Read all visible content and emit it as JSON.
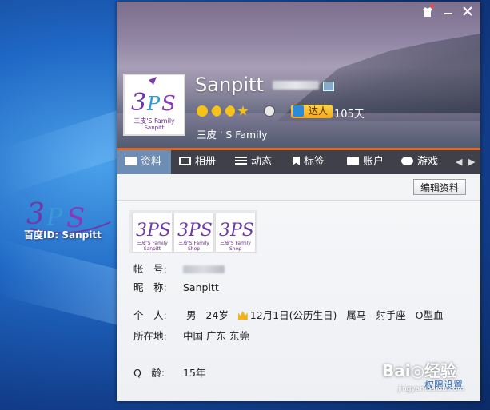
{
  "profile": {
    "nickname": "Sanpitt",
    "signature": "三皮 ' S Family",
    "days": "105天",
    "talent_badge": "达人",
    "avatar_caption": "三皮'S Family",
    "avatar_caption2": "Sanpitt"
  },
  "desktop": {
    "watermark_text": "百度ID: Sanpitt"
  },
  "tabs": [
    {
      "label": "资料"
    },
    {
      "label": "相册"
    },
    {
      "label": "动态"
    },
    {
      "label": "标签"
    },
    {
      "label": "账户"
    },
    {
      "label": "游戏"
    }
  ],
  "toolbar": {
    "edit_label": "编辑资料"
  },
  "photos": [
    {
      "caption": "三皮'S Family Sanpitt"
    },
    {
      "caption": "三皮'S Family Shop"
    },
    {
      "caption": "三皮'S Family Shop"
    }
  ],
  "info": {
    "account_label": "帐　号:",
    "nick_label": "昵　称:",
    "nick_value": "Sanpitt",
    "personal_label": "个　人:",
    "gender": "男",
    "age": "24岁",
    "birthday": "12月1日(公历生日)",
    "zodiac": "属马",
    "star_sign": "射手座",
    "blood": "O型血",
    "location_label": "所在地:",
    "location_value": "中国 广东 东莞",
    "qage_label": "Q　龄:",
    "qage_value": "15年"
  },
  "footer": {
    "permissions": "权限设置",
    "baidu_brand": "Bai◎经验",
    "baidu_url": "jingyan.baidu.com"
  },
  "colors": {
    "tab_accent": "#e9661f",
    "tab_bg": "#3f4049",
    "tab_active": "#6d8db5",
    "link": "#2f6fc2"
  }
}
